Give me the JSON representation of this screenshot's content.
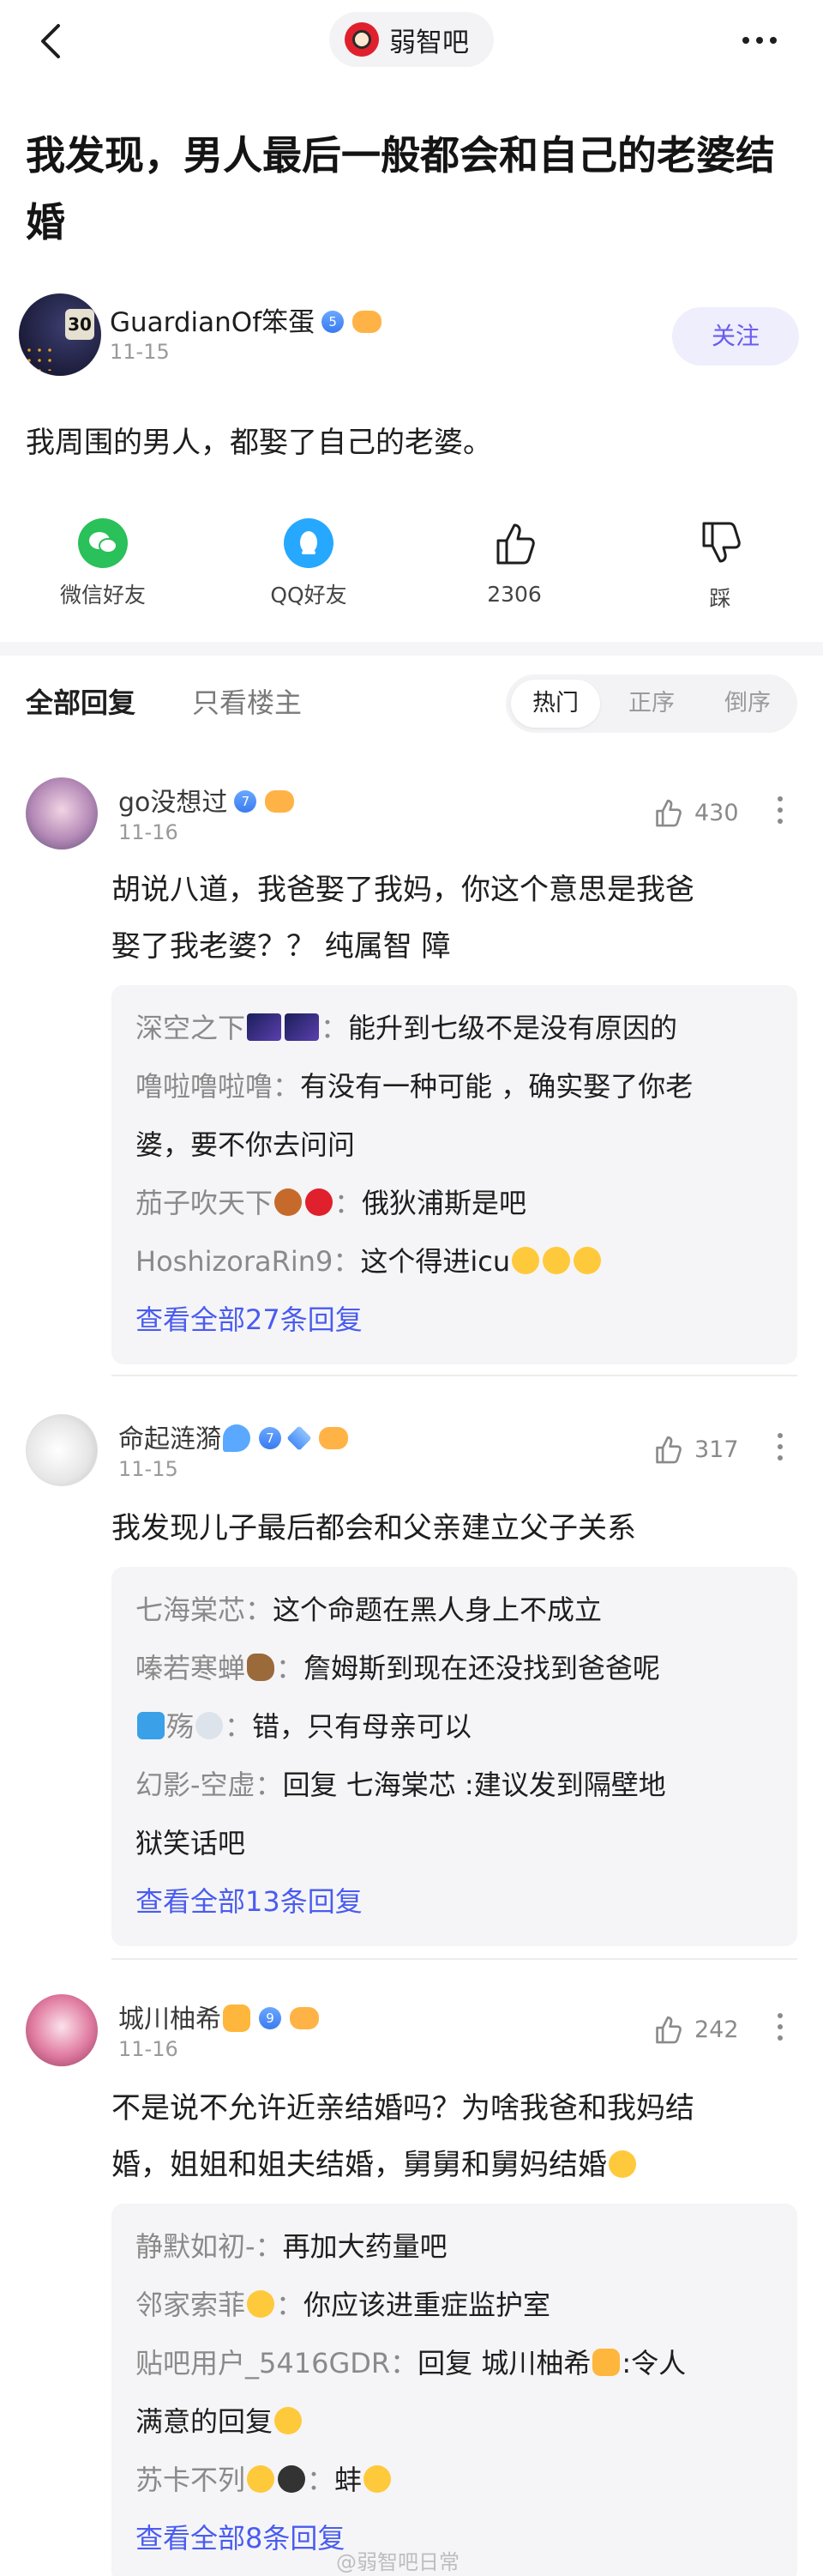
{
  "header": {
    "forum_name": "弱智吧"
  },
  "post": {
    "title": "我发现，男人最后一般都会和自己的老婆结婚",
    "author": "GuardianOf笨蛋",
    "author_level": "5",
    "date": "11-15",
    "follow_label": "关注",
    "body": "我周围的男人，都娶了自己的老婆。"
  },
  "actions": {
    "wechat": "微信好友",
    "qq": "QQ好友",
    "likes": "2306",
    "dislike": "踩"
  },
  "tabs": {
    "all": "全部回复",
    "op_only": "只看楼主",
    "sort": [
      "热门",
      "正序",
      "倒序"
    ],
    "sort_active": "热门"
  },
  "comments": [
    {
      "user": "go没想过",
      "level": "7",
      "date": "11-16",
      "likes": "430",
      "text_lines": [
        "胡说八道，我爸娶了我妈，你这个意思是我爸",
        "娶了我老婆？？ 纯属智 障"
      ],
      "replies": [
        {
          "user": "深空之下",
          "text": "能升到七级不是没有原因的",
          "cont": ""
        },
        {
          "user": "噜啦噜啦噜",
          "text": "有没有一种可能 ，确实娶了你老",
          "cont": "婆，要不你去问问"
        },
        {
          "user": "茄子吹天下",
          "text": "俄狄浦斯是吧",
          "cont": ""
        },
        {
          "user": "HoshizoraRin9",
          "text": "这个得进icu",
          "cont": ""
        }
      ],
      "more": "查看全部27条回复"
    },
    {
      "user": "命起涟漪",
      "level": "7",
      "date": "11-15",
      "likes": "317",
      "text_lines": [
        "我发现儿子最后都会和父亲建立父子关系"
      ],
      "replies": [
        {
          "user": "七海棠芯",
          "text": "这个命题在黑人身上不成立",
          "cont": ""
        },
        {
          "user": "嗪若寒蝉",
          "text": "詹姆斯到现在还没找到爸爸呢",
          "cont": ""
        },
        {
          "user": "殇",
          "text": "错，只有母亲可以",
          "cont": ""
        },
        {
          "user": "幻影-空虚",
          "text": "回复  七海棠芯 :建议发到隔壁地",
          "cont": "狱笑话吧"
        }
      ],
      "more": "查看全部13条回复"
    },
    {
      "user": "城川柚希",
      "level": "9",
      "date": "11-16",
      "likes": "242",
      "text_lines": [
        "不是说不允许近亲结婚吗？为啥我爸和我妈结",
        "婚，姐姐和姐夫结婚，舅舅和舅妈结婚"
      ],
      "replies": [
        {
          "user": "静默如初-",
          "text": "再加大药量吧",
          "cont": ""
        },
        {
          "user": "邻家索菲",
          "text": "你应该进重症监护室",
          "cont": ""
        },
        {
          "user": "贴吧用户_5416GDR",
          "text": "回复  城川柚希",
          "text2": ":令人",
          "cont": "满意的回复"
        },
        {
          "user": "苏卡不列",
          "text": "蚌",
          "cont": ""
        }
      ],
      "more": "查看全部8条回复"
    }
  ],
  "watermark": "@弱智吧日常",
  "colors": {
    "accent": "#4a5cf0",
    "follow_bg": "#eeeefc",
    "follow_text": "#6a5cf0",
    "wechat": "#2ac05a",
    "qq": "#26a8ff"
  }
}
